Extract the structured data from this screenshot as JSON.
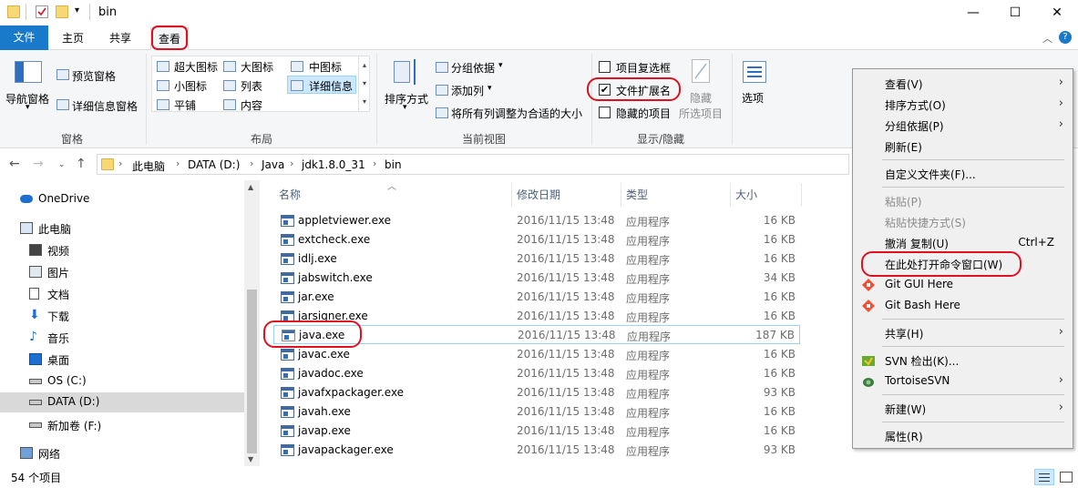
{
  "window": {
    "title": "bin",
    "minimize": "—",
    "maximize": "☐",
    "close": "✕"
  },
  "ribbon_tabs": [
    "文件",
    "主页",
    "共享",
    "查看"
  ],
  "ribbon": {
    "panes": {
      "nav_pane": "导航窗格",
      "preview_pane": "预览窗格",
      "details_pane": "详细信息窗格",
      "group": "窗格"
    },
    "layout": {
      "items": [
        "超大图标",
        "大图标",
        "中图标",
        "小图标",
        "列表",
        "详细信息",
        "平铺",
        "内容"
      ],
      "group": "布局"
    },
    "current_view": {
      "sort_by": "排序方式",
      "group_by": "分组依据",
      "add_columns": "添加列",
      "fit_columns": "将所有列调整为合适的大小",
      "group": "当前视图"
    },
    "show_hide": {
      "item_checkboxes": "项目复选框",
      "file_extensions": "文件扩展名",
      "hidden_items": "隐藏的项目",
      "hide_selected": "隐藏",
      "hide_selected_sub": "所选项目",
      "options": "选项",
      "group": "显示/隐藏"
    }
  },
  "address": {
    "crumbs": [
      "此电脑",
      "DATA (D:)",
      "Java",
      "jdk1.8.0_31",
      "bin"
    ]
  },
  "sidebar": {
    "items": [
      "OneDrive",
      "此电脑",
      "视频",
      "图片",
      "文档",
      "下载",
      "音乐",
      "桌面",
      "OS (C:)",
      "DATA (D:)",
      "新加卷 (F:)",
      "网络"
    ]
  },
  "columns": {
    "name": "名称",
    "date": "修改日期",
    "type": "类型",
    "size": "大小"
  },
  "files": [
    {
      "name": "appletviewer.exe",
      "date": "2016/11/15 13:48",
      "type": "应用程序",
      "size": "16 KB"
    },
    {
      "name": "extcheck.exe",
      "date": "2016/11/15 13:48",
      "type": "应用程序",
      "size": "16 KB"
    },
    {
      "name": "idlj.exe",
      "date": "2016/11/15 13:48",
      "type": "应用程序",
      "size": "16 KB"
    },
    {
      "name": "jabswitch.exe",
      "date": "2016/11/15 13:48",
      "type": "应用程序",
      "size": "34 KB"
    },
    {
      "name": "jar.exe",
      "date": "2016/11/15 13:48",
      "type": "应用程序",
      "size": "16 KB"
    },
    {
      "name": "jarsigner.exe",
      "date": "2016/11/15 13:48",
      "type": "应用程序",
      "size": "16 KB"
    },
    {
      "name": "java.exe",
      "date": "2016/11/15 13:48",
      "type": "应用程序",
      "size": "187 KB"
    },
    {
      "name": "javac.exe",
      "date": "2016/11/15 13:48",
      "type": "应用程序",
      "size": "16 KB"
    },
    {
      "name": "javadoc.exe",
      "date": "2016/11/15 13:48",
      "type": "应用程序",
      "size": "16 KB"
    },
    {
      "name": "javafxpackager.exe",
      "date": "2016/11/15 13:48",
      "type": "应用程序",
      "size": "93 KB"
    },
    {
      "name": "javah.exe",
      "date": "2016/11/15 13:48",
      "type": "应用程序",
      "size": "16 KB"
    },
    {
      "name": "javap.exe",
      "date": "2016/11/15 13:48",
      "type": "应用程序",
      "size": "16 KB"
    },
    {
      "name": "javapackager.exe",
      "date": "2016/11/15 13:48",
      "type": "应用程序",
      "size": "93 KB"
    }
  ],
  "status": {
    "count": "54 个项目"
  },
  "context_menu": {
    "view": "查看(V)",
    "sort": "排序方式(O)",
    "group": "分组依据(P)",
    "refresh": "刷新(E)",
    "customize": "自定义文件夹(F)...",
    "paste": "粘贴(P)",
    "paste_shortcut": "粘贴快捷方式(S)",
    "undo": "撤消 复制(U)",
    "undo_shortcut": "Ctrl+Z",
    "open_cmd": "在此处打开命令窗口(W)",
    "git_gui": "Git GUI Here",
    "git_bash": "Git Bash Here",
    "share": "共享(H)",
    "svn_checkout": "SVN 检出(K)...",
    "tortoise": "TortoiseSVN",
    "new": "新建(W)",
    "properties": "属性(R)"
  },
  "colors": {
    "accent": "#1979ca",
    "highlight_ring": "#e0101e"
  }
}
